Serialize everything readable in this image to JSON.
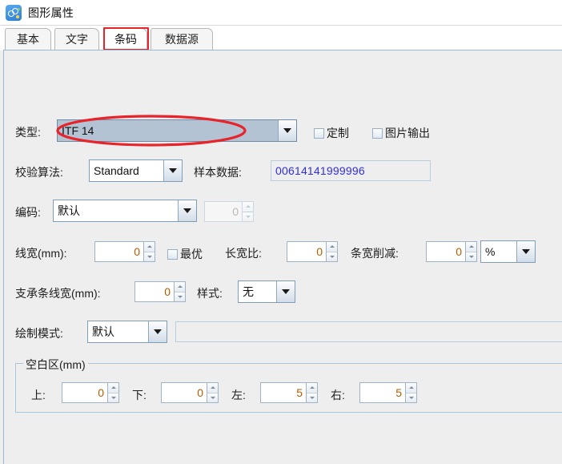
{
  "window": {
    "title": "图形属性",
    "icon": "graphic-properties-icon"
  },
  "tabs": [
    {
      "label": "基本",
      "selected": false
    },
    {
      "label": "文字",
      "selected": false
    },
    {
      "label": "条码",
      "selected": true
    },
    {
      "label": "数据源",
      "selected": false
    }
  ],
  "annotations": {
    "tab_highlight_color": "#e8232a",
    "type_ellipse_color": "#e8232a"
  },
  "form": {
    "type": {
      "label": "类型:",
      "value": "ITF 14",
      "arrow_icon": "chevron-down-icon"
    },
    "custom_checkbox": {
      "label": "定制",
      "checked": false
    },
    "image_output_checkbox": {
      "label": "图片输出",
      "checked": false
    },
    "checksum": {
      "label": "校验算法:",
      "value": "Standard",
      "arrow_icon": "chevron-down-icon"
    },
    "sample_data": {
      "label": "样本数据:",
      "value": "00614141999996",
      "color": "#2f2fe0"
    },
    "encoding": {
      "label": "编码:",
      "value": "默认",
      "arrow_icon": "chevron-down-icon"
    },
    "encoding_spinner": {
      "value": "0",
      "enabled": false
    },
    "line_width": {
      "label": "线宽(mm):",
      "value": "0"
    },
    "optimal_checkbox": {
      "label": "最优",
      "checked": false
    },
    "aspect_ratio": {
      "label": "长宽比:",
      "value": "0"
    },
    "bar_width_reduction": {
      "label": "条宽削减:",
      "value": "0",
      "unit": "%",
      "unit_arrow_icon": "chevron-down-icon"
    },
    "bearer_bar_width": {
      "label": "支承条线宽(mm):",
      "value": "0"
    },
    "bearer_style": {
      "label": "样式:",
      "value": "无",
      "arrow_icon": "chevron-down-icon"
    },
    "draw_mode": {
      "label": "绘制模式:",
      "value": "默认",
      "arrow_icon": "chevron-down-icon"
    },
    "draw_mode_readonly": {
      "value": ""
    },
    "quiet_zone": {
      "title": "空白区(mm)",
      "top": {
        "label": "上:",
        "value": "0"
      },
      "bottom": {
        "label": "下:",
        "value": "0"
      },
      "left": {
        "label": "左:",
        "value": "5"
      },
      "right": {
        "label": "右:",
        "value": "5"
      }
    }
  }
}
